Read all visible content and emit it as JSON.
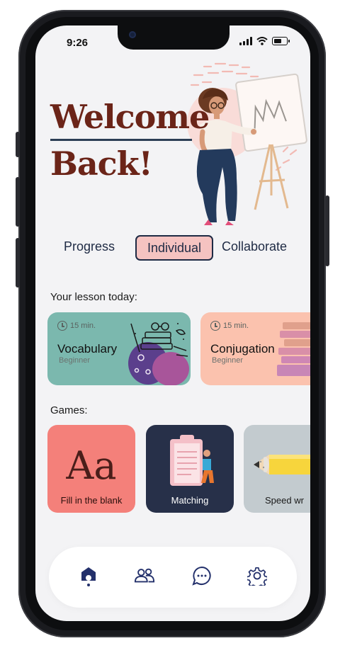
{
  "status_bar": {
    "time": "9:26"
  },
  "header": {
    "welcome_line1": "Welcome",
    "welcome_line2": "Back!"
  },
  "tabs": [
    {
      "label": "Progress",
      "active": false
    },
    {
      "label": "Individual",
      "active": true
    },
    {
      "label": "Collaborate",
      "active": false
    }
  ],
  "lessons": {
    "section_title": "Your lesson today:",
    "items": [
      {
        "duration": "15 min.",
        "title": "Vocabulary",
        "level": "Beginner",
        "color": "#7bb8ae",
        "icon": "books-illustration"
      },
      {
        "duration": "15 min.",
        "title": "Conjugation",
        "level": "Beginner",
        "color": "#fbc2ae",
        "icon": "book-stack-illustration"
      }
    ]
  },
  "games": {
    "section_title": "Games:",
    "items": [
      {
        "label": "Fill in the blank",
        "glyph": "Aa",
        "color": "#f4807a"
      },
      {
        "label": "Matching",
        "color": "#273049"
      },
      {
        "label": "Speed wr",
        "color": "#c3cbcf"
      }
    ]
  },
  "nav": {
    "items": [
      {
        "icon": "home-icon",
        "active": true
      },
      {
        "icon": "people-icon",
        "active": false
      },
      {
        "icon": "chat-icon",
        "active": false
      },
      {
        "icon": "settings-icon",
        "active": false
      }
    ]
  },
  "colors": {
    "brand_red": "#6b2418",
    "navy": "#1e2a44",
    "active_tab_bg": "#f5c3c1"
  }
}
